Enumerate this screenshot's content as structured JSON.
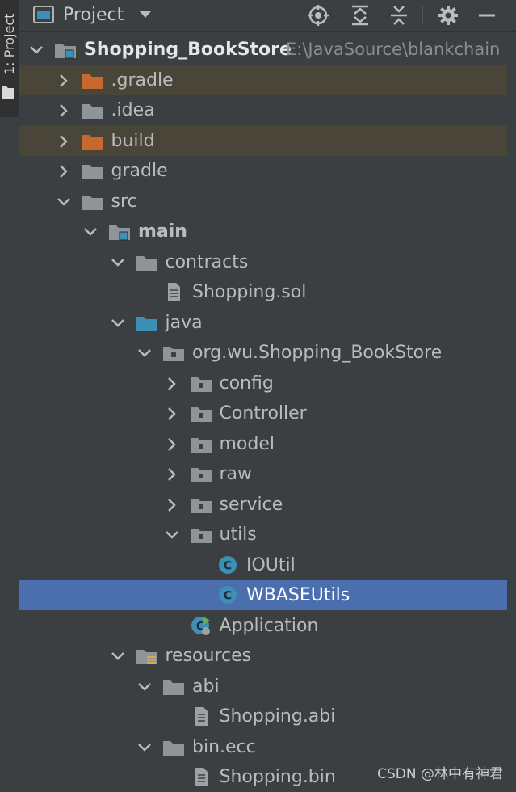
{
  "tool_strip": {
    "label": "1: Project"
  },
  "header": {
    "title": "Project"
  },
  "tree": [
    {
      "label": "Shopping_BookStore",
      "path": "E:\\JavaSource\\blankchain",
      "icon": "module-folder-icon",
      "arrow": "expanded",
      "depth": 0,
      "bold": true
    },
    {
      "label": ".gradle",
      "icon": "excluded-folder-icon",
      "arrow": "collapsed",
      "depth": 1,
      "highlight": "vcs"
    },
    {
      "label": ".idea",
      "icon": "folder-icon",
      "arrow": "collapsed",
      "depth": 1
    },
    {
      "label": "build",
      "icon": "excluded-folder-icon",
      "arrow": "collapsed",
      "depth": 1,
      "highlight": "vcs"
    },
    {
      "label": "gradle",
      "icon": "folder-icon",
      "arrow": "collapsed",
      "depth": 1
    },
    {
      "label": "src",
      "icon": "folder-icon",
      "arrow": "expanded",
      "depth": 1
    },
    {
      "label": "main",
      "icon": "module-folder-icon",
      "arrow": "expanded",
      "depth": 2,
      "bold": true
    },
    {
      "label": "contracts",
      "icon": "folder-icon",
      "arrow": "expanded",
      "depth": 3
    },
    {
      "label": "Shopping.sol",
      "icon": "file-icon",
      "arrow": "none",
      "depth": 4
    },
    {
      "label": "java",
      "icon": "source-folder-icon",
      "arrow": "expanded",
      "depth": 3
    },
    {
      "label": "org.wu.Shopping_BookStore",
      "icon": "package-icon",
      "arrow": "expanded",
      "depth": 4
    },
    {
      "label": "config",
      "icon": "package-icon",
      "arrow": "collapsed",
      "depth": 5
    },
    {
      "label": "Controller",
      "icon": "package-icon",
      "arrow": "collapsed",
      "depth": 5
    },
    {
      "label": "model",
      "icon": "package-icon",
      "arrow": "collapsed",
      "depth": 5
    },
    {
      "label": "raw",
      "icon": "package-icon",
      "arrow": "collapsed",
      "depth": 5
    },
    {
      "label": "service",
      "icon": "package-icon",
      "arrow": "collapsed",
      "depth": 5
    },
    {
      "label": "utils",
      "icon": "package-icon",
      "arrow": "expanded",
      "depth": 5
    },
    {
      "label": "IOUtil",
      "icon": "class-icon",
      "arrow": "none",
      "depth": 6
    },
    {
      "label": "WBASEUtils",
      "icon": "class-icon",
      "arrow": "none",
      "depth": 6,
      "highlight": "selected"
    },
    {
      "label": "Application",
      "icon": "spring-boot-app-icon",
      "arrow": "none",
      "depth": 5
    },
    {
      "label": "resources",
      "icon": "resources-folder-icon",
      "arrow": "expanded",
      "depth": 3
    },
    {
      "label": "abi",
      "icon": "folder-icon",
      "arrow": "expanded",
      "depth": 4
    },
    {
      "label": "Shopping.abi",
      "icon": "file-icon",
      "arrow": "none",
      "depth": 5
    },
    {
      "label": "bin.ecc",
      "icon": "folder-icon",
      "arrow": "expanded",
      "depth": 4
    },
    {
      "label": "Shopping.bin",
      "icon": "file-icon",
      "arrow": "none",
      "depth": 5
    }
  ],
  "watermark": "CSDN @林中有神君",
  "colors": {
    "background": "#3c3f41",
    "selection": "#4b6eaf",
    "vcs_ignored_row": "#4a4539",
    "folder": "#8f9499",
    "excluded_folder": "#c8682e",
    "source_folder": "#3d8fb5",
    "class_badge": "#3d8fb5"
  }
}
